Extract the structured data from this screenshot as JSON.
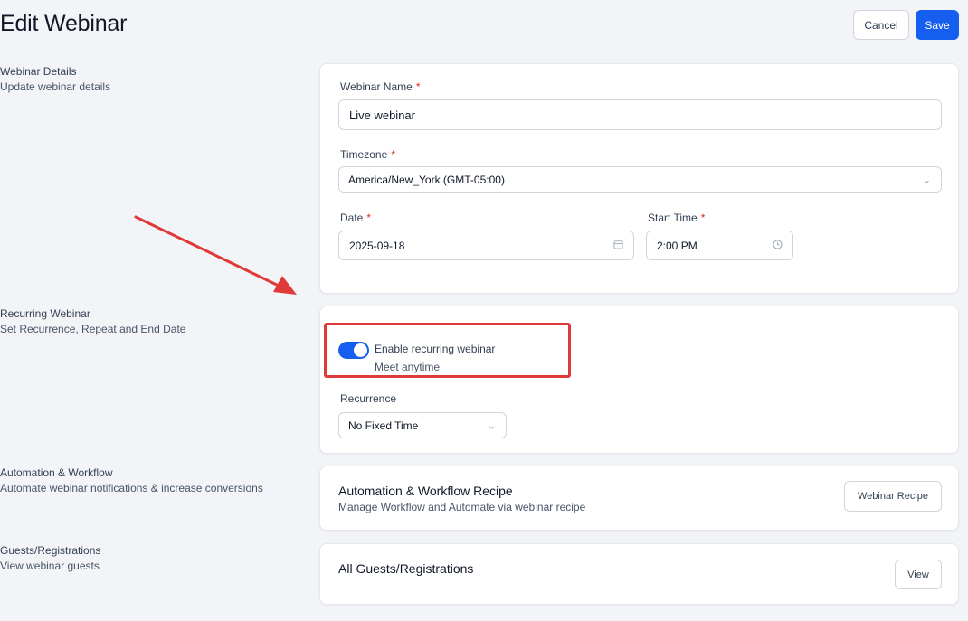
{
  "header": {
    "title": "Edit Webinar",
    "cancel_label": "Cancel",
    "save_label": "Save"
  },
  "sections": {
    "details": {
      "title": "Webinar Details",
      "subtitle": "Update webinar details"
    },
    "recurring": {
      "title": "Recurring Webinar",
      "subtitle": "Set Recurrence, Repeat and End Date"
    },
    "automation": {
      "title": "Automation & Workflow",
      "subtitle": "Automate webinar notifications & increase conversions"
    },
    "guests": {
      "title": "Guests/Registrations",
      "subtitle": "View webinar guests"
    }
  },
  "details_form": {
    "name_label": "Webinar Name",
    "name_value": "Live webinar",
    "timezone_label": "Timezone",
    "timezone_value": "America/New_York (GMT-05:00)",
    "date_label": "Date",
    "date_value": "2025-09-18",
    "time_label": "Start Time",
    "time_value": "2:00 PM",
    "required_mark": "*"
  },
  "recurring_form": {
    "toggle_on": true,
    "toggle_label": "Enable recurring webinar",
    "toggle_sub": "Meet anytime",
    "recurrence_label": "Recurrence",
    "recurrence_value": "No Fixed Time"
  },
  "automation_card": {
    "title": "Automation & Workflow Recipe",
    "subtitle": "Manage Workflow and Automate via webinar recipe",
    "button_label": "Webinar Recipe"
  },
  "guests_card": {
    "title": "All Guests/Registrations",
    "button_label": "View"
  },
  "colors": {
    "primary": "#155eef",
    "annotation": "#e0393a",
    "background": "#f2f4f7"
  }
}
